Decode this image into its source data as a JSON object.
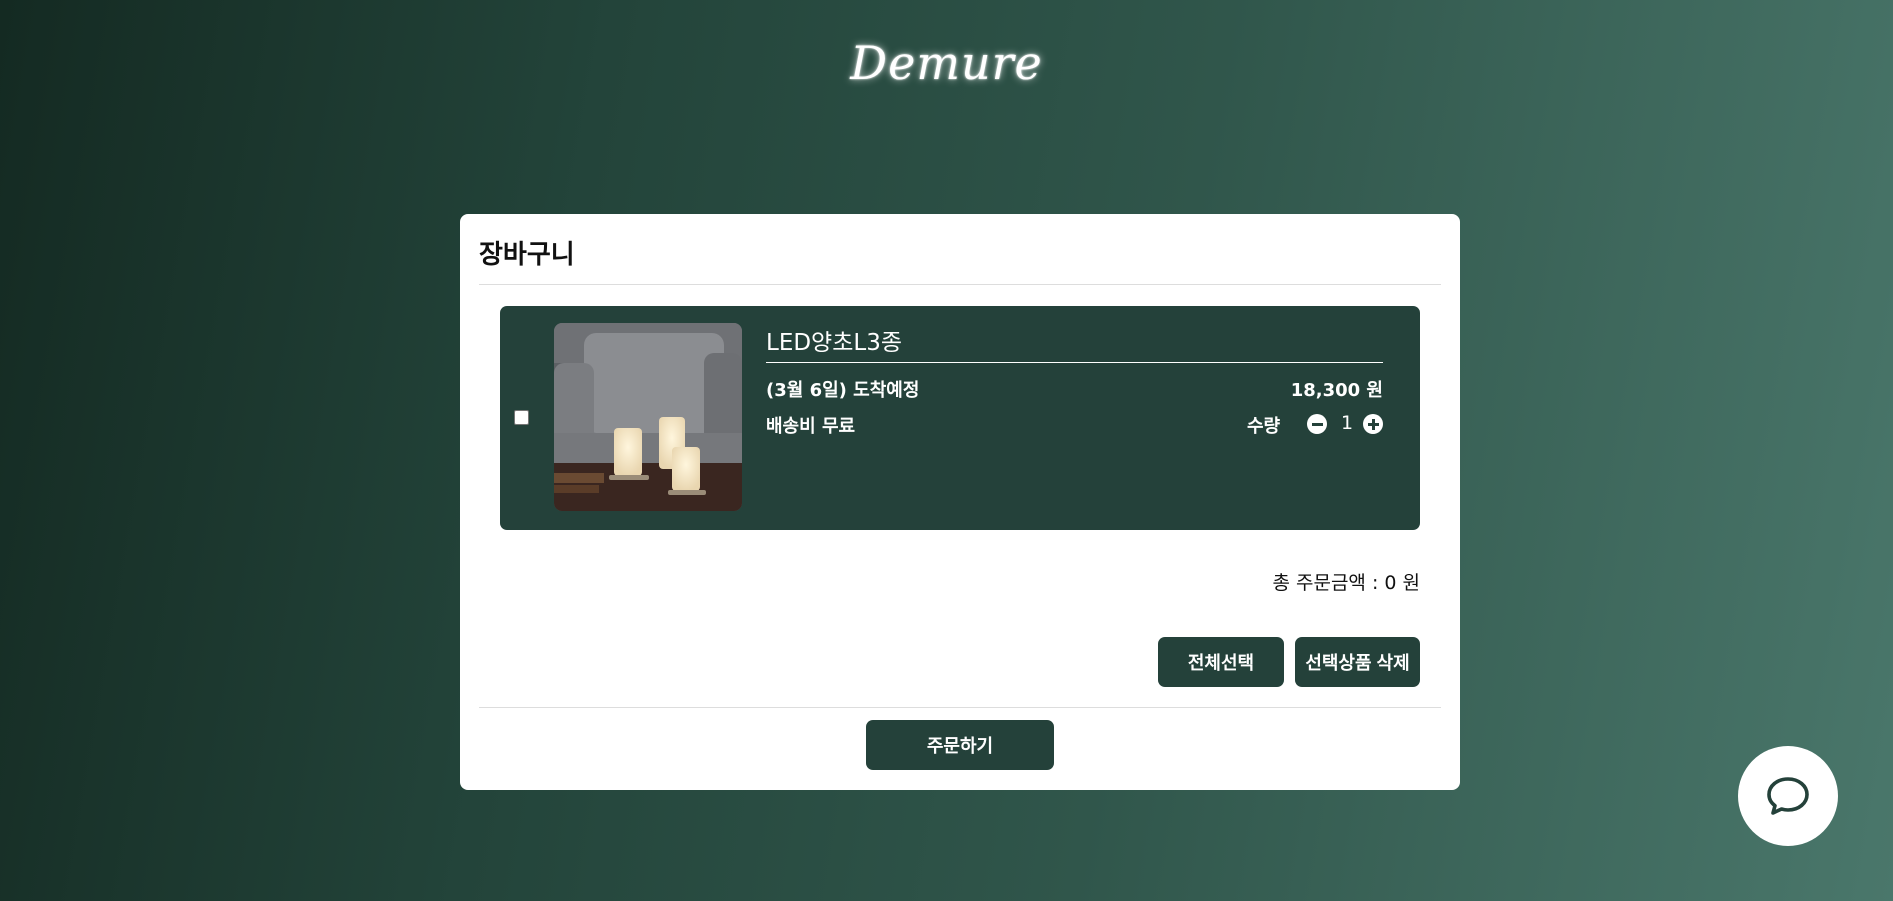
{
  "brand": {
    "logo_text": "Demure"
  },
  "cart": {
    "title": "장바구니",
    "items": [
      {
        "name": "LED양초L3종",
        "arrival": "(3월 6일) 도착예정",
        "price": "18,300 원",
        "shipping": "배송비 무료",
        "quantity_label": "수량",
        "quantity": "1",
        "checked": false
      }
    ],
    "total": "총 주문금액 : 0 원",
    "select_all_label": "전체선택",
    "delete_selected_label": "선택상품 삭제",
    "order_label": "주문하기"
  },
  "colors": {
    "accent": "#24413a",
    "card": "#ffffff"
  },
  "icons": {
    "chat": "chat-bubble-icon",
    "minus": "minus-circle-icon",
    "plus": "plus-circle-icon"
  }
}
